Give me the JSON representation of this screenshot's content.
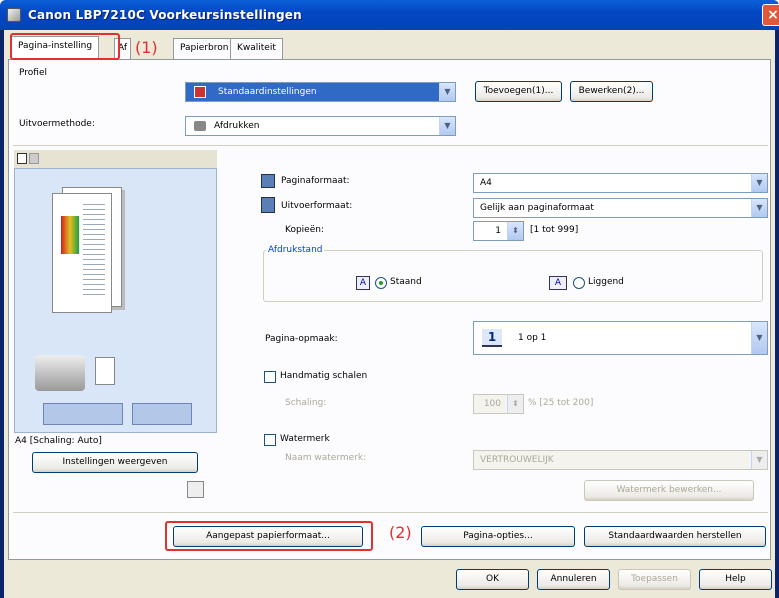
{
  "window": {
    "title": "Canon LBP7210C Voorkeursinstellingen",
    "close": "×"
  },
  "tabs": [
    "Pagina-instelling",
    "Af",
    "Papierbron",
    "Kwaliteit"
  ],
  "callouts": [
    "(1)",
    "(2)"
  ],
  "profiel": {
    "label": "Profiel",
    "value": "Standaardinstellingen",
    "add": "Toevoegen(1)...",
    "edit": "Bewerken(2)..."
  },
  "uitvoer": {
    "label": "Uitvoermethode:",
    "value": "Afdrukken"
  },
  "paper": {
    "pagesize_label": "Paginaformaat:",
    "pagesize": "A4",
    "output_label": "Uitvoerformaat:",
    "output": "Gelijk aan paginaformaat",
    "copies_label": "Kopieën:",
    "copies": "1",
    "copies_range": "[1 tot 999]"
  },
  "orientation": {
    "title": "Afdrukstand",
    "portrait": "Staand",
    "landscape": "Liggend",
    "glyph": "A"
  },
  "layout": {
    "label": "Pagina-opmaak:",
    "value": "1 op 1",
    "icon_num": "1"
  },
  "scale": {
    "manual": "Handmatig schalen",
    "label": "Schaling:",
    "value": "100",
    "range": "% [25 tot 200]"
  },
  "watermark": {
    "check": "Watermerk",
    "name_label": "Naam watermerk:",
    "name": "VERTROUWELIJK",
    "edit": "Watermerk bewerken..."
  },
  "preview": {
    "status": "A4 [Schaling: Auto]",
    "view_settings": "Instellingen weergeven"
  },
  "bottom_buttons": {
    "custom": "Aangepast papierformaat...",
    "options": "Pagina-opties...",
    "defaults": "Standaardwaarden herstellen"
  },
  "dialog": {
    "ok": "OK",
    "cancel": "Annuleren",
    "apply": "Toepassen",
    "help": "Help"
  }
}
